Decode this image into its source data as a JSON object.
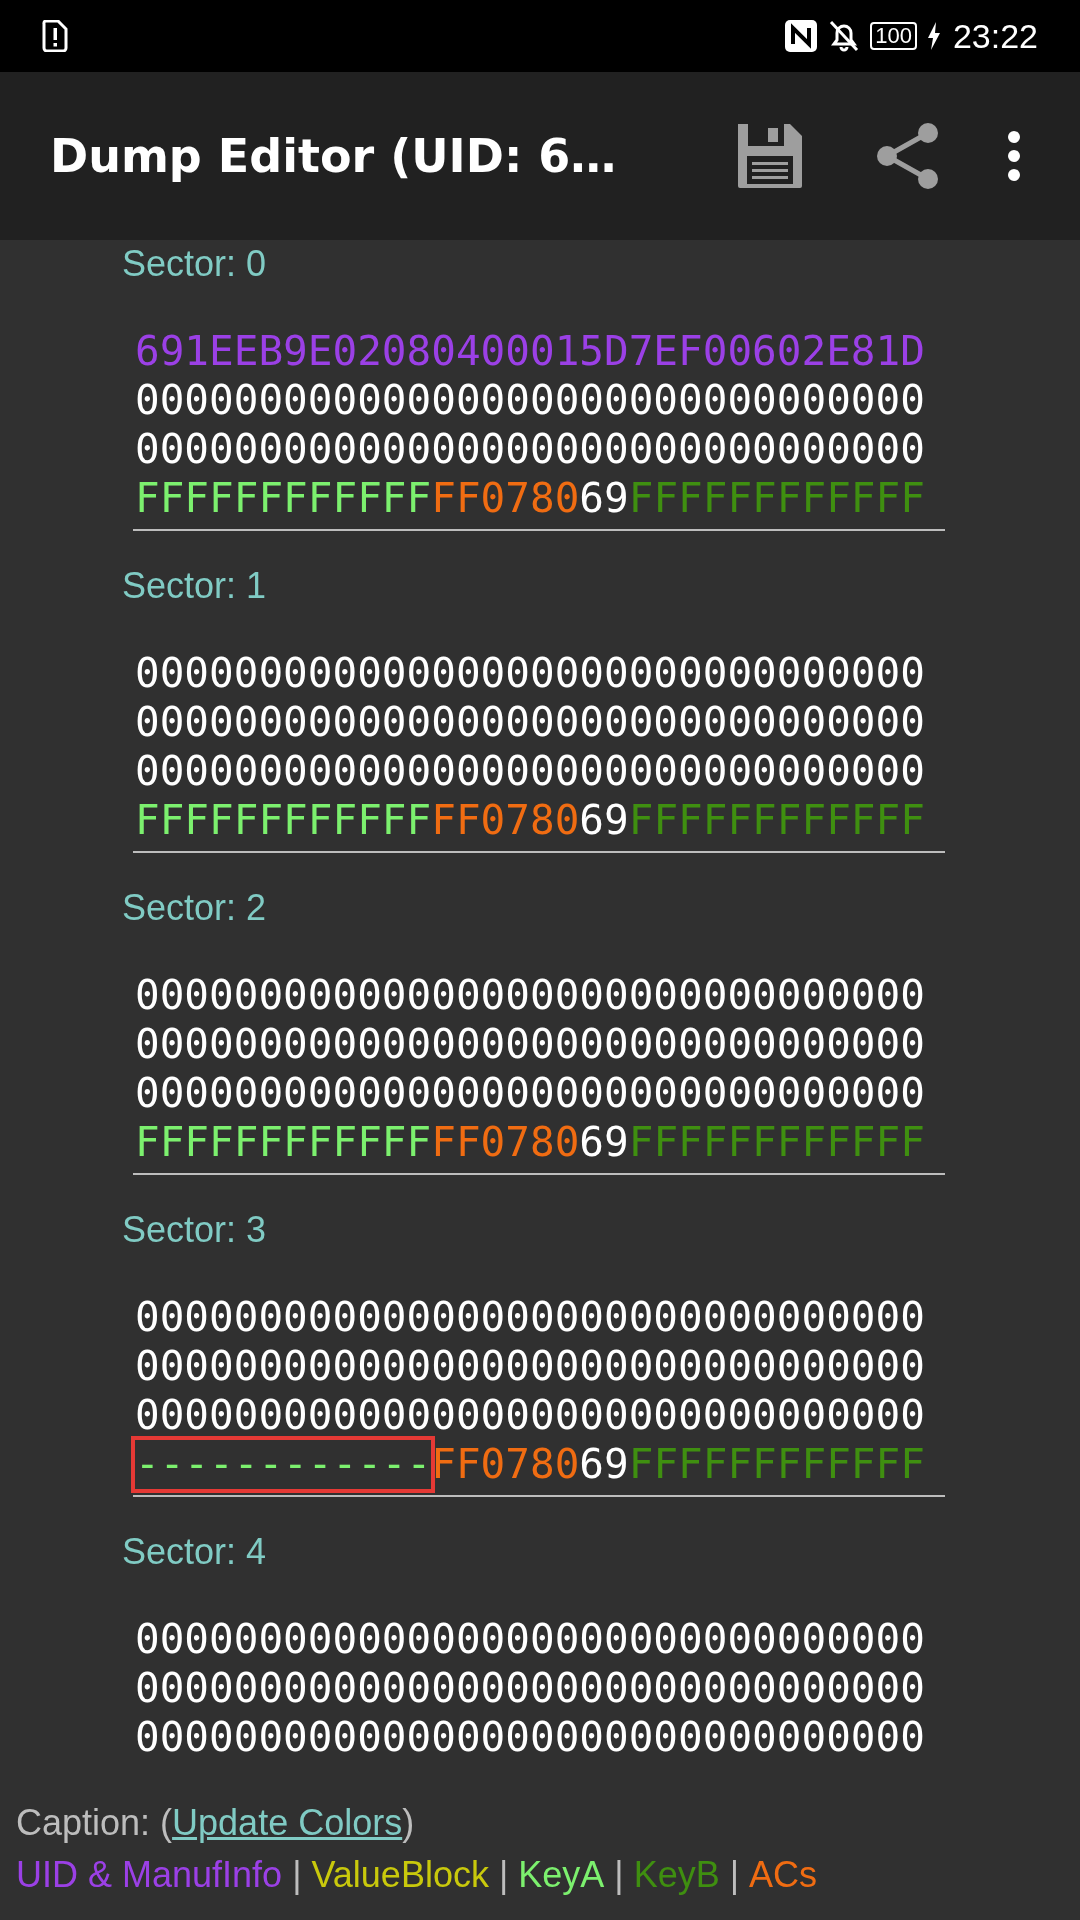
{
  "status_bar": {
    "battery": "100",
    "time": "23:22"
  },
  "app_bar": {
    "title": "Dump Editor (UID: 6…"
  },
  "sectors": [
    {
      "label": "Sector: 0",
      "blocks": [
        {
          "kind": "uid",
          "text": "691EEB9E02080400015D7EF00602E81D"
        },
        {
          "kind": "data",
          "text": "00000000000000000000000000000000"
        },
        {
          "kind": "data",
          "text": "00000000000000000000000000000000"
        }
      ],
      "trailer": {
        "key_a": "FFFFFFFFFFFF",
        "key_a_highlighted": false,
        "access_bits": "FF0780",
        "user_byte": "69",
        "key_b": "FFFFFFFFFFFF"
      }
    },
    {
      "label": "Sector: 1",
      "blocks": [
        {
          "kind": "data",
          "text": "00000000000000000000000000000000"
        },
        {
          "kind": "data",
          "text": "00000000000000000000000000000000"
        },
        {
          "kind": "data",
          "text": "00000000000000000000000000000000"
        }
      ],
      "trailer": {
        "key_a": "FFFFFFFFFFFF",
        "key_a_highlighted": false,
        "access_bits": "FF0780",
        "user_byte": "69",
        "key_b": "FFFFFFFFFFFF"
      }
    },
    {
      "label": "Sector: 2",
      "blocks": [
        {
          "kind": "data",
          "text": "00000000000000000000000000000000"
        },
        {
          "kind": "data",
          "text": "00000000000000000000000000000000"
        },
        {
          "kind": "data",
          "text": "00000000000000000000000000000000"
        }
      ],
      "trailer": {
        "key_a": "FFFFFFFFFFFF",
        "key_a_highlighted": false,
        "access_bits": "FF0780",
        "user_byte": "69",
        "key_b": "FFFFFFFFFFFF"
      }
    },
    {
      "label": "Sector: 3",
      "blocks": [
        {
          "kind": "data",
          "text": "00000000000000000000000000000000"
        },
        {
          "kind": "data",
          "text": "00000000000000000000000000000000"
        },
        {
          "kind": "data",
          "text": "00000000000000000000000000000000"
        }
      ],
      "trailer": {
        "key_a": "------------",
        "key_a_highlighted": true,
        "access_bits": "FF0780",
        "user_byte": "69",
        "key_b": "FFFFFFFFFFFF"
      }
    },
    {
      "label": "Sector: 4",
      "blocks": [
        {
          "kind": "data",
          "text": "00000000000000000000000000000000"
        },
        {
          "kind": "data",
          "text": "00000000000000000000000000000000"
        },
        {
          "kind": "data",
          "text": "00000000000000000000000000000000"
        }
      ]
    }
  ],
  "caption": {
    "label": "Caption: (",
    "link": "Update Colors",
    "close": ")",
    "legend": [
      {
        "kind": "uid",
        "text": "UID & ManufInfo"
      },
      {
        "kind": "separator",
        "text": "|"
      },
      {
        "kind": "value",
        "text": "ValueBlock"
      },
      {
        "kind": "separator",
        "text": "|"
      },
      {
        "kind": "keya",
        "text": "KeyA"
      },
      {
        "kind": "separator",
        "text": "|"
      },
      {
        "kind": "keyb",
        "text": "KeyB"
      },
      {
        "kind": "separator",
        "text": "|"
      },
      {
        "kind": "ac",
        "text": "ACs"
      }
    ]
  }
}
